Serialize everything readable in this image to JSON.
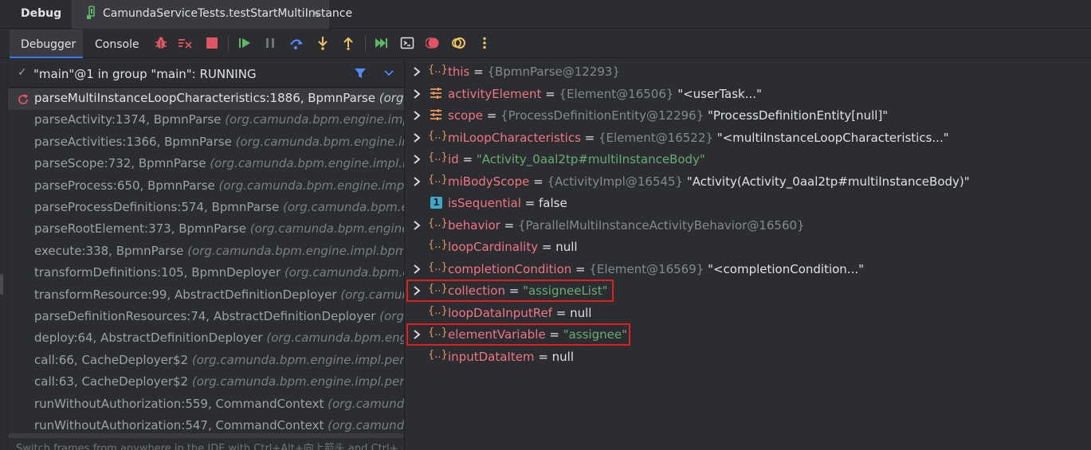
{
  "window": {
    "title": "Debug",
    "tab_label": "CamundaServiceTests.testStartMultiInstance",
    "tab_close": "✕"
  },
  "toolbar": {
    "debugger_label": "Debugger",
    "console_label": "Console"
  },
  "threads": {
    "check": "✓",
    "current": "\"main\"@1 in group \"main\": RUNNING"
  },
  "frames": [
    {
      "method": "parseMultiInstanceLoopCharacteristics:1886, BpmnParse",
      "pkg": "(org."
    },
    {
      "method": "parseActivity:1374, BpmnParse",
      "pkg": "(org.camunda.bpm.engine.impl."
    },
    {
      "method": "parseActivities:1366, BpmnParse",
      "pkg": "(org.camunda.bpm.engine.imp"
    },
    {
      "method": "parseScope:732, BpmnParse",
      "pkg": "(org.camunda.bpm.engine.impl.bp"
    },
    {
      "method": "parseProcess:650, BpmnParse",
      "pkg": "(org.camunda.bpm.engine.impl.b"
    },
    {
      "method": "parseProcessDefinitions:574, BpmnParse",
      "pkg": "(org.camunda.bpm.eng"
    },
    {
      "method": "parseRootElement:373, BpmnParse",
      "pkg": "(org.camunda.bpm.engine.i"
    },
    {
      "method": "execute:338, BpmnParse",
      "pkg": "(org.camunda.bpm.engine.impl.bpmn."
    },
    {
      "method": "transformDefinitions:105, BpmnDeployer",
      "pkg": "(org.camunda.bpm.en"
    },
    {
      "method": "transformResource:99, AbstractDefinitionDeployer",
      "pkg": "(org.camunc"
    },
    {
      "method": "parseDefinitionResources:74, AbstractDefinitionDeployer",
      "pkg": "(org.c"
    },
    {
      "method": "deploy:64, AbstractDefinitionDeployer",
      "pkg": "(org.camunda.bpm.engi"
    },
    {
      "method": "call:66, CacheDeployer$2",
      "pkg": "(org.camunda.bpm.engine.impl.persis"
    },
    {
      "method": "call:63, CacheDeployer$2",
      "pkg": "(org.camunda.bpm.engine.impl.persis"
    },
    {
      "method": "runWithoutAuthorization:559, CommandContext",
      "pkg": "(org.camunda."
    },
    {
      "method": "runWithoutAuthorization:547, CommandContext",
      "pkg": "(org.camunda."
    }
  ],
  "hint": "Switch frames from anywhere in the IDE with Ctrl+Alt+向上箭头 and Ctrl+",
  "variables": [
    {
      "name": "this",
      "eq": " = ",
      "type": "{BpmnParse@12293}",
      "value": "",
      "str": false,
      "expand": true,
      "icon": "object"
    },
    {
      "name": "activityElement",
      "eq": " = ",
      "type": "{Element@16506}",
      "value": " \"<userTask...\"",
      "str": false,
      "expand": true,
      "icon": "field"
    },
    {
      "name": "scope",
      "eq": " = ",
      "type": "{ProcessDefinitionEntity@12296}",
      "value": " \"ProcessDefinitionEntity[null]\"",
      "str": false,
      "expand": true,
      "icon": "field"
    },
    {
      "name": "miLoopCharacteristics",
      "eq": " = ",
      "type": "{Element@16522}",
      "value": " \"<multiInstanceLoopCharacteristics...\"",
      "str": false,
      "expand": true,
      "icon": "object"
    },
    {
      "name": "id",
      "eq": " = ",
      "type": "",
      "value": "\"Activity_0aal2tp#multiInstanceBody\"",
      "str": true,
      "expand": true,
      "icon": "object"
    },
    {
      "name": "miBodyScope",
      "eq": " = ",
      "type": "{ActivityImpl@16545}",
      "value": " \"Activity(Activity_0aal2tp#multiInstanceBody)\"",
      "str": false,
      "expand": true,
      "icon": "object"
    },
    {
      "name": "isSequential",
      "eq": " = ",
      "type": "",
      "value": "false",
      "str": false,
      "expand": false,
      "icon": "primitive"
    },
    {
      "name": "behavior",
      "eq": " = ",
      "type": "{ParallelMultiInstanceActivityBehavior@16560}",
      "value": "",
      "str": false,
      "expand": true,
      "icon": "object"
    },
    {
      "name": "loopCardinality",
      "eq": " = ",
      "type": "",
      "value": "null",
      "str": false,
      "expand": false,
      "icon": "object"
    },
    {
      "name": "completionCondition",
      "eq": " = ",
      "type": "{Element@16569}",
      "value": " \"<completionCondition...\"",
      "str": false,
      "expand": true,
      "icon": "object"
    },
    {
      "name": "collection",
      "eq": " = ",
      "type": "",
      "value": "\"assigneeList\"",
      "str": true,
      "expand": true,
      "icon": "object"
    },
    {
      "name": "loopDataInputRef",
      "eq": " = ",
      "type": "",
      "value": "null",
      "str": false,
      "expand": false,
      "icon": "object"
    },
    {
      "name": "elementVariable",
      "eq": " = ",
      "type": "",
      "value": "\"assignee\"",
      "str": true,
      "expand": true,
      "icon": "object"
    },
    {
      "name": "inputDataItem",
      "eq": " = ",
      "type": "",
      "value": "null",
      "str": false,
      "expand": false,
      "icon": "object"
    }
  ],
  "icon_glyphs": {
    "object": "{..}",
    "primitive": "1"
  },
  "colors": {
    "accent": "#3574f0",
    "highlight": "#e02020",
    "var_name": "#f07583",
    "string_value": "#6aab73"
  }
}
